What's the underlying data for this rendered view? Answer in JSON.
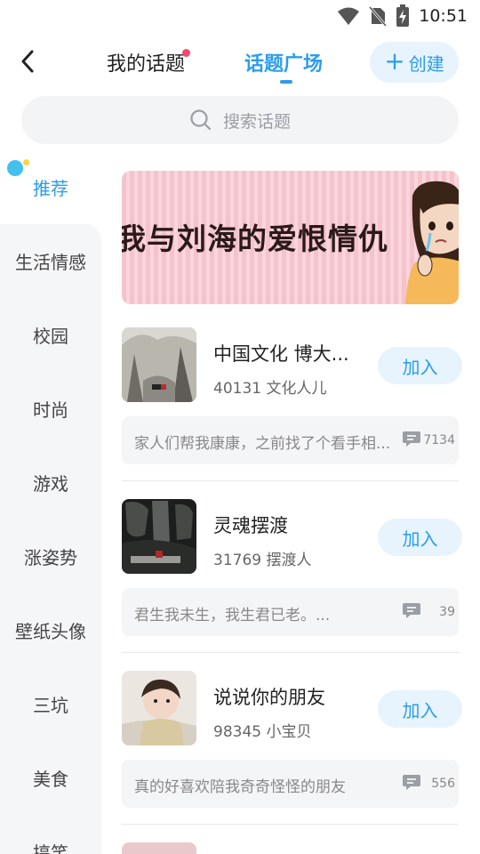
{
  "status_bar": {
    "time": "10:51"
  },
  "header": {
    "tabs": [
      {
        "label": "我的话题",
        "has_dot": true
      },
      {
        "label": "话题广场",
        "active": true
      }
    ],
    "create_label": "创建"
  },
  "search": {
    "placeholder": "搜索话题"
  },
  "sidebar": {
    "items": [
      {
        "label": "推荐",
        "active": true
      },
      {
        "label": "生活情感"
      },
      {
        "label": "校园"
      },
      {
        "label": "时尚"
      },
      {
        "label": "游戏"
      },
      {
        "label": "涨姿势"
      },
      {
        "label": "壁纸头像"
      },
      {
        "label": "三坑"
      },
      {
        "label": "美食"
      },
      {
        "label": "搞笑"
      }
    ]
  },
  "banner": {
    "text": "我与刘海的爱恨情仇"
  },
  "topics": [
    {
      "title": "中国文化 博大...",
      "meta": "40131 文化人儿",
      "join_label": "加入",
      "post_text": "家人们帮我康康，之前找了个看手相...",
      "post_count": "7134"
    },
    {
      "title": "灵魂摆渡",
      "meta": "31769 摆渡人",
      "join_label": "加入",
      "post_text": "君生我未生，我生君已老。...",
      "post_count": "39"
    },
    {
      "title": "说说你的朋友",
      "meta": "98345 小宝贝",
      "join_label": "加入",
      "post_text": "真的好喜欢陪我奇奇怪怪的朋友",
      "post_count": "556"
    }
  ],
  "colors": {
    "accent": "#2c9dea",
    "accent_light": "#e8f4fd",
    "badge": "#f24a6e"
  }
}
